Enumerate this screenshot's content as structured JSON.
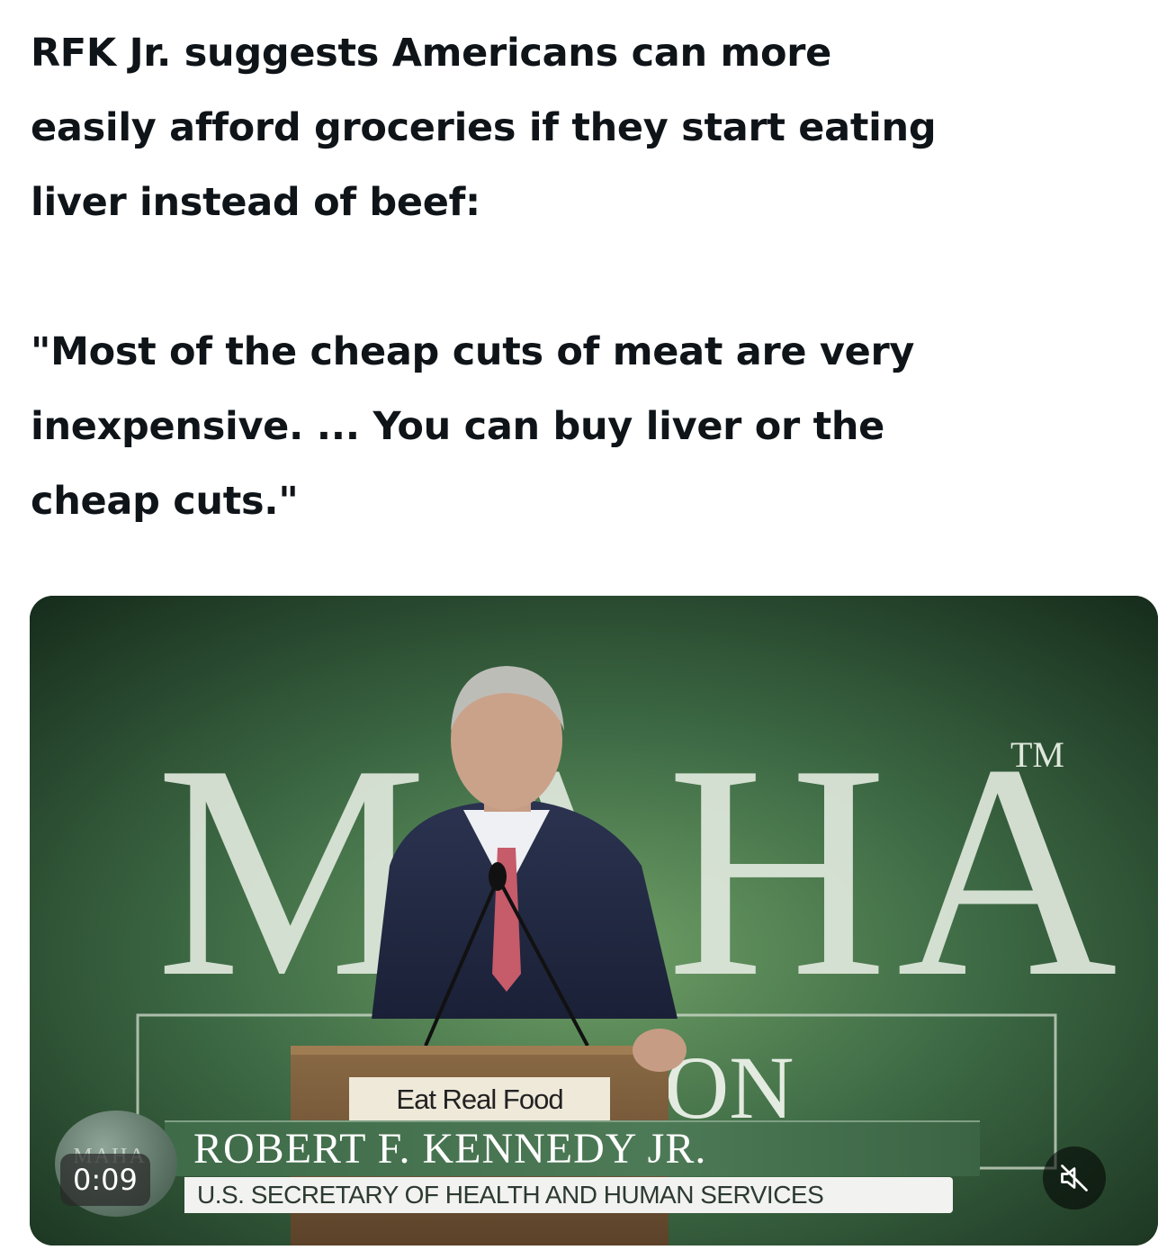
{
  "post": {
    "headline": "RFK Jr. suggests Americans can more\neasily afford groceries if they start eating\nliver instead of beef:",
    "quote": "\"Most of the cheap cuts of meat are very\ninexpensive. ... You can buy liver or the\ncheap cuts.\""
  },
  "video": {
    "backdrop_text": "MAHA",
    "backdrop_tm": "TM",
    "backdrop_lower": "ON",
    "podium_sign": "Eat Real Food",
    "lower_third": {
      "name": "ROBERT F. KENNEDY JR.",
      "title": "U.S. SECRETARY OF HEALTH AND HUMAN SERVICES",
      "logo": "MAHA"
    },
    "timestamp": "0:09",
    "mute_icon": "speaker-muted-icon"
  },
  "colors": {
    "text": "#0f1419",
    "backdrop_green": "#2f5a36",
    "lower_third_green": "#4d7a56"
  }
}
